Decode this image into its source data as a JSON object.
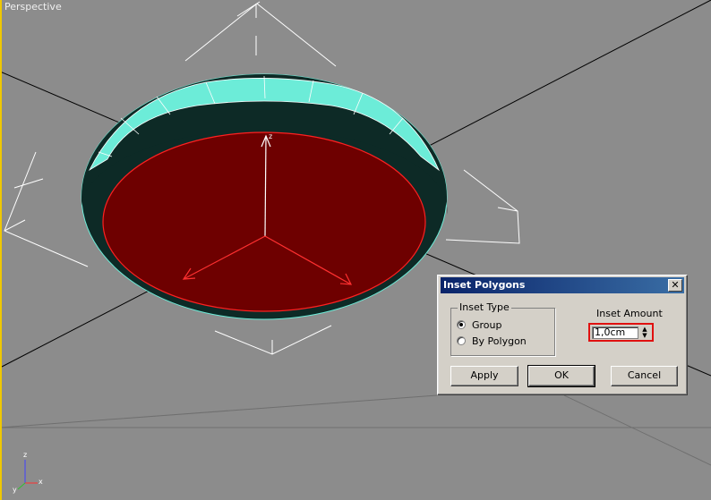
{
  "viewport": {
    "label": "Perspective",
    "axis_gizmo": {
      "x": "x",
      "y": "y",
      "z": "z"
    },
    "colors": {
      "background": "#8c8c8c",
      "cylinder_side": "#6cecd8",
      "cylinder_inner": "#0d2a26",
      "selected_face": "#6e0000",
      "selection": "#ff2020",
      "gizmo": "#ffffff"
    }
  },
  "dialog": {
    "title": "Inset Polygons",
    "close_glyph": "✕",
    "inset_type": {
      "label": "Inset Type",
      "options": [
        {
          "label": "Group",
          "checked": true
        },
        {
          "label": "By Polygon",
          "checked": false
        }
      ]
    },
    "inset_amount": {
      "label": "Inset Amount",
      "value": "1,0cm"
    },
    "buttons": {
      "apply": "Apply",
      "ok": "OK",
      "cancel": "Cancel"
    }
  }
}
